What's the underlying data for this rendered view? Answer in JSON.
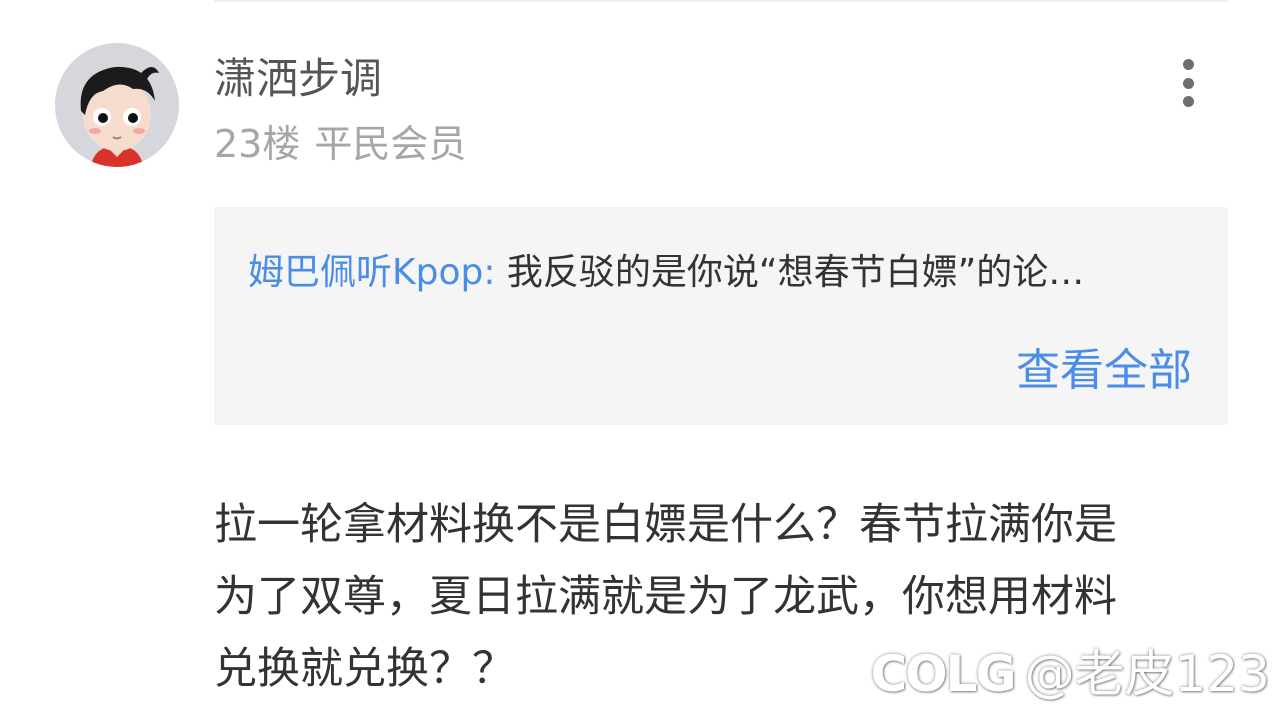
{
  "post": {
    "username": "潇洒步调",
    "floor": "23楼",
    "member_level": "平民会员",
    "avatar_icon": "cartoon-boy-avatar",
    "more_icon": "vertical-dots-icon"
  },
  "quote": {
    "author": "姆巴佩听Kpop:",
    "text": " 我反驳的是你说“想春节白嫖”的论…",
    "view_all_label": "查看全部"
  },
  "comment": {
    "lines": [
      "拉一轮拿材料换不是白嫖是什么？春节拉满你是",
      "为了双尊，夏日拉满就是为了龙武，你想用材料",
      "兑换就兑换？？"
    ]
  },
  "watermark": {
    "logo": "COLG",
    "handle": "@老皮123"
  },
  "colors": {
    "link": "#4a8de6",
    "username": "#555555",
    "meta": "#a6a6a6",
    "quote_background": "#f5f5f5",
    "body_text": "#333333"
  }
}
